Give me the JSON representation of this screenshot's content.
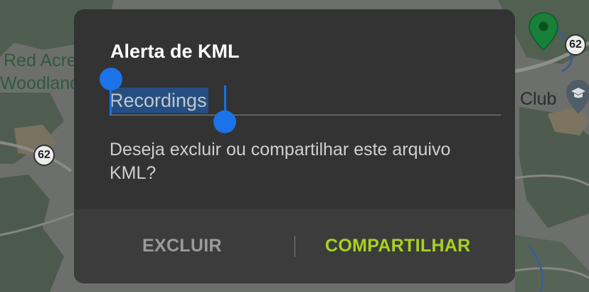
{
  "map": {
    "labels": [
      "Red Acre",
      "Woodland",
      "Club"
    ],
    "route_shields": [
      "62",
      "62"
    ],
    "icons": {
      "pin": "map-pin-icon",
      "school": "school-icon"
    },
    "colors": {
      "land": "#6f706e",
      "forest": "#4d5a4d",
      "pin": "#188038"
    }
  },
  "dialog": {
    "title": "Alerta de KML",
    "input_value": "Recordings",
    "message": "Deseja excluir ou compartilhar este arquivo KML?",
    "buttons": {
      "delete": "EXCLUIR",
      "share": "COMPARTILHAR"
    },
    "colors": {
      "background": "#333334",
      "accent": "#a9d11f",
      "selection": "#1a73e8"
    }
  }
}
